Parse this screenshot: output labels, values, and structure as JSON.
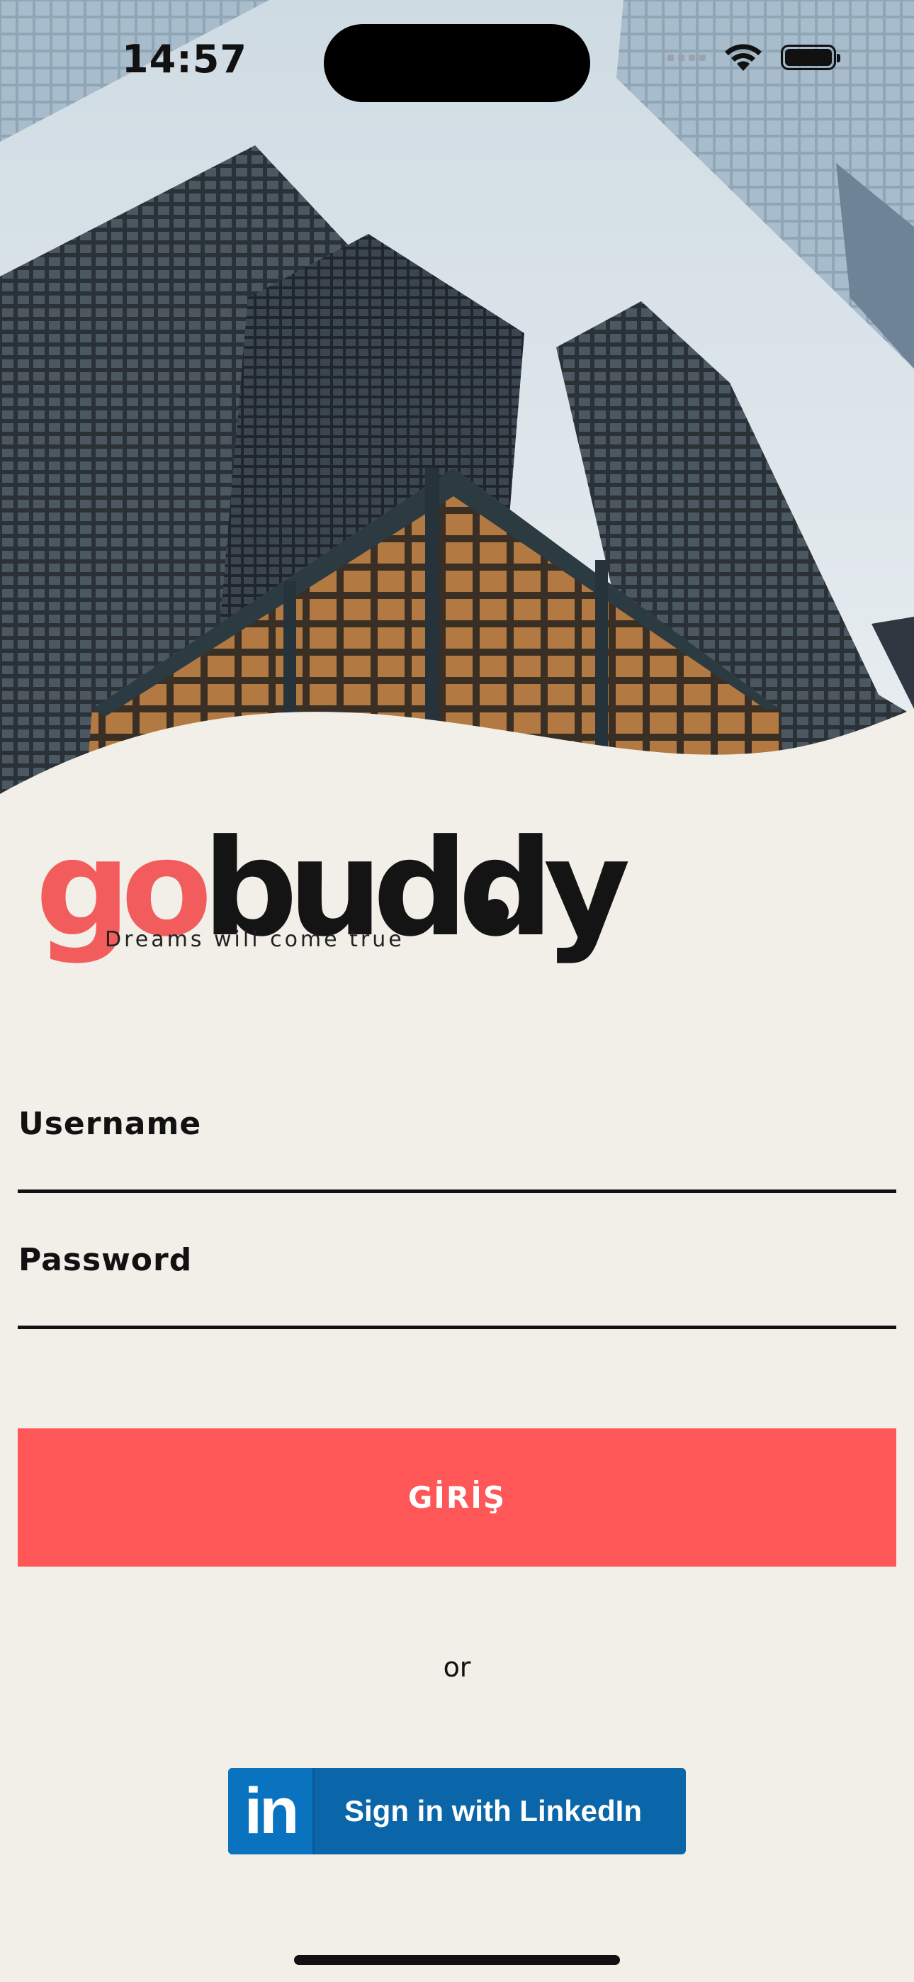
{
  "status_bar": {
    "time": "14:57"
  },
  "hero": {
    "description": "skyscrapers"
  },
  "logo": {
    "part1": "go",
    "part2": "buddy",
    "tagline": "Dreams will come true"
  },
  "form": {
    "username_label": "Username",
    "password_label": "Password",
    "login_button": "GİRİŞ",
    "or_text": "or",
    "linkedin_mark": "in",
    "linkedin_label": "Sign in with LinkedIn"
  },
  "colors": {
    "accent": "#ff5757",
    "brand_go": "#f25c5c",
    "background": "#f2efe9",
    "linkedin": "#0a66a8"
  },
  "icons": [
    "wifi-icon",
    "battery-icon",
    "signal-icon",
    "linkedin-icon"
  ]
}
